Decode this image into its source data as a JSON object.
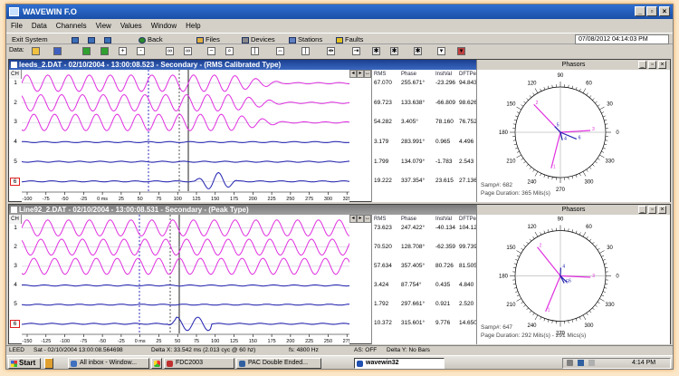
{
  "app": {
    "title": "WAVEWIN F.O"
  },
  "menu": [
    "File",
    "Data",
    "Channels",
    "View",
    "Values",
    "Window",
    "Help"
  ],
  "toolbar": {
    "exit": "Exit System",
    "back": "Back",
    "files": "Files",
    "devices": "Devices",
    "stations": "Stations",
    "faults": "Faults",
    "datetime": "07/08/2012  04:14:03 PM",
    "data_label": "Data:"
  },
  "panel1": {
    "title": "leeds_2.DAT - 02/10/2004 - 13:00:08.523 - Secondary - (RMS Calibrated Type)",
    "phasors_title": "Phasors",
    "ch_label": "CH",
    "cols": [
      "RMS",
      "Phase",
      "InstVal",
      "DFTPe"
    ],
    "channels": [
      {
        "num": "1",
        "rms": "67.070",
        "phase": "255.671°",
        "inst": "-23.296",
        "dft": "94.843"
      },
      {
        "num": "2",
        "rms": "69.723",
        "phase": "133.638°",
        "inst": "-66.809",
        "dft": "98.626"
      },
      {
        "num": "3",
        "rms": "54.282",
        "phase": "3.405°",
        "inst": "78.160",
        "dft": "76.752"
      },
      {
        "num": "4",
        "rms": "3.179",
        "phase": "283.991°",
        "inst": "0.965",
        "dft": "4.496"
      },
      {
        "num": "5",
        "rms": "1.799",
        "phase": "134.079°",
        "inst": "-1.783",
        "dft": "2.543"
      },
      {
        "num": "6",
        "rms": "19.222",
        "phase": "337.354°",
        "inst": "23.615",
        "dft": "27.136"
      }
    ],
    "sample": "Samp#: 682",
    "duration": "Page Duration: 365 Mils(s)",
    "ticks": [
      "-100",
      "-75",
      "-50",
      "-25",
      "0 ms",
      "25",
      "50",
      "75",
      "100",
      "125",
      "150",
      "175",
      "200",
      "225",
      "250",
      "275",
      "300",
      "325",
      "350"
    ]
  },
  "panel2": {
    "title": "Line92_2.DAT - 02/10/2004 - 13:00:08.531 - Secondary - (Peak Type)",
    "phasors_title": "Phasors",
    "ch_label": "CH",
    "cols": [
      "RMS",
      "Phase",
      "InstVal",
      "DFTPe"
    ],
    "channels": [
      {
        "num": "1",
        "rms": "73.623",
        "phase": "247.422°",
        "inst": "-40.134",
        "dft": "104.122"
      },
      {
        "num": "2",
        "rms": "70.520",
        "phase": "128.708°",
        "inst": "-62.359",
        "dft": "99.739"
      },
      {
        "num": "3",
        "rms": "57.634",
        "phase": "357.405°",
        "inst": "80.726",
        "dft": "81.505"
      },
      {
        "num": "4",
        "rms": "3.424",
        "phase": "87.754°",
        "inst": "0.435",
        "dft": "4.840"
      },
      {
        "num": "5",
        "rms": "1.792",
        "phase": "297.661°",
        "inst": "0.921",
        "dft": "2.520"
      },
      {
        "num": "6",
        "rms": "10.372",
        "phase": "315.601°",
        "inst": "9.776",
        "dft": "14.650"
      }
    ],
    "sample": "Samp#: 647",
    "duration": "Page Duration: 292 Mils(s) - 291 Mics(s)",
    "ticks": [
      "-150",
      "-125",
      "-100",
      "-75",
      "-50",
      "-25",
      "0 ms",
      "25",
      "50",
      "75",
      "100",
      "125",
      "150",
      "175",
      "200",
      "225",
      "250",
      "275",
      "300"
    ]
  },
  "angles": [
    "90",
    "60",
    "30",
    "0",
    "330",
    "300",
    "270",
    "240",
    "210",
    "180",
    "150",
    "120"
  ],
  "status": {
    "station": "LEED",
    "time": "Sat - 02/10/2004 13:00:08.564698",
    "delta": "Delta X: 33.542 ms  (2.013 cyc @ 60 hz)",
    "fs": "fs:  4800 Hz",
    "as": "AS: OFF",
    "deltay": "Delta Y:  No Bars"
  },
  "taskbar": {
    "start": "Start",
    "tasks": [
      "All inbox - Window...",
      "FDC2003",
      "PAC Double Ended...",
      "wavewin32"
    ],
    "time": "4:14 PM"
  },
  "colors": {
    "magenta": "#e030e0",
    "blue": "#2020b0",
    "accent": "#1b4fa8"
  }
}
